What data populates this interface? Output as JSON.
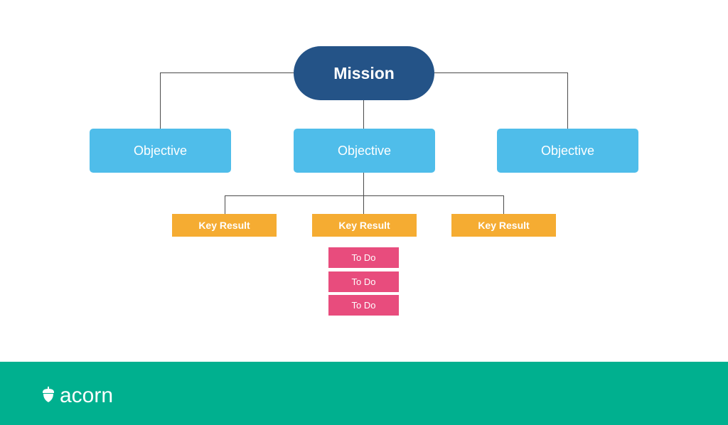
{
  "diagram": {
    "mission": {
      "label": "Mission"
    },
    "objectives": [
      {
        "label": "Objective"
      },
      {
        "label": "Objective"
      },
      {
        "label": "Objective"
      }
    ],
    "key_results": [
      {
        "label": "Key Result"
      },
      {
        "label": "Key Result"
      },
      {
        "label": "Key Result"
      }
    ],
    "todos": [
      {
        "label": "To Do"
      },
      {
        "label": "To Do"
      },
      {
        "label": "To Do"
      }
    ]
  },
  "footer": {
    "brand": "acorn",
    "logo_icon": "acorn-icon"
  },
  "colors": {
    "mission": "#245387",
    "objective": "#4fbdea",
    "key_result": "#f5ac32",
    "todo": "#e84c7d",
    "footer": "#00b08f",
    "connector": "#4a4a4a"
  }
}
